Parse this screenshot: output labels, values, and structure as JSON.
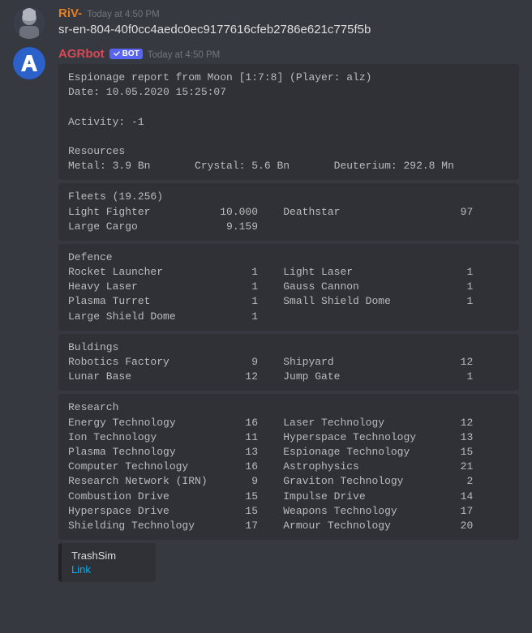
{
  "message1": {
    "author": "RiV-",
    "timestamp": "Today at 4:50 PM",
    "content": "sr-en-804-40f0cc4aedc0ec9177616cfeb2786e621c775f5b"
  },
  "message2": {
    "author": "AGRbot",
    "bot_tag": "BOT",
    "timestamp": "Today at 4:50 PM",
    "embed_header": "Espionage report from Moon [1:7:8] (Player: alz)\nDate: 10.05.2020 15:25:07\n\nActivity: -1\n\nResources\nMetal: 3.9 Bn       Crystal: 5.6 Bn       Deuterium: 292.8 Mn",
    "embed_fleets": "Fleets (19.256)\nLight Fighter           10.000    Deathstar                   97\nLarge Cargo              9.159",
    "embed_defence": "Defence\nRocket Launcher              1    Light Laser                  1\nHeavy Laser                  1    Gauss Cannon                 1\nPlasma Turret                1    Small Shield Dome            1\nLarge Shield Dome            1",
    "embed_buildings": "Buldings\nRobotics Factory             9    Shipyard                    12\nLunar Base                  12    Jump Gate                    1",
    "embed_research": "Research\nEnergy Technology           16    Laser Technology            12\nIon Technology              11    Hyperspace Technology       13\nPlasma Technology           13    Espionage Technology        15\nComputer Technology         16    Astrophysics                21\nResearch Network (IRN)       9    Graviton Technology          2\nCombustion Drive            15    Impulse Drive               14\nHyperspace Drive            15    Weapons Technology          17\nShielding Technology        17    Armour Technology           20",
    "trashsim": {
      "title": "TrashSim",
      "link": "Link"
    }
  }
}
